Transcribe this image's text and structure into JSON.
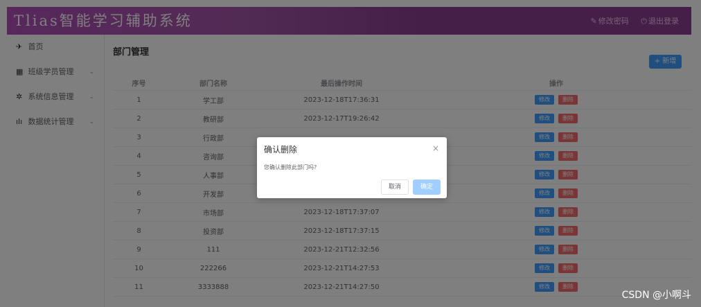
{
  "header": {
    "logo": "Tlias智能学习辅助系统",
    "change_password": "修改密码",
    "logout": "退出登录"
  },
  "sidebar": {
    "items": [
      {
        "label": "首页",
        "icon": "send-icon",
        "glyph": "✈"
      },
      {
        "label": "班级学员管理",
        "icon": "grid-icon",
        "glyph": "▦"
      },
      {
        "label": "系统信息管理",
        "icon": "gear-icon",
        "glyph": "✲"
      },
      {
        "label": "数据统计管理",
        "icon": "bar-chart-icon",
        "glyph": "ılı"
      }
    ],
    "chevron": "⌄"
  },
  "main": {
    "title": "部门管理",
    "add_button": "+ 新增",
    "table": {
      "headers": [
        "序号",
        "部门名称",
        "最后操作时间",
        "操作"
      ],
      "rows": [
        {
          "index": "1",
          "name": "学工部",
          "time": "2023-12-18T17:36:31"
        },
        {
          "index": "2",
          "name": "教研部",
          "time": "2023-12-17T19:26:42"
        },
        {
          "index": "3",
          "name": "行政部",
          "time": ""
        },
        {
          "index": "4",
          "name": "咨询部",
          "time": ""
        },
        {
          "index": "5",
          "name": "人事部",
          "time": ""
        },
        {
          "index": "6",
          "name": "开发部",
          "time": ""
        },
        {
          "index": "7",
          "name": "市场部",
          "time": "2023-12-18T17:37:07"
        },
        {
          "index": "8",
          "name": "投资部",
          "time": "2023-12-18T17:37:15"
        },
        {
          "index": "9",
          "name": "111",
          "time": "2023-12-21T12:32:56"
        },
        {
          "index": "10",
          "name": "222266",
          "time": "2023-12-21T14:27:53"
        },
        {
          "index": "11",
          "name": "3333888",
          "time": "2023-12-21T14:27:50"
        }
      ],
      "edit_label": "修改",
      "delete_label": "删除"
    }
  },
  "dialog": {
    "title": "确认删除",
    "message": "您确认删除此部门吗?",
    "cancel": "取消",
    "confirm": "确定",
    "close_glyph": "×"
  },
  "watermark": "CSDN @小啊斗"
}
